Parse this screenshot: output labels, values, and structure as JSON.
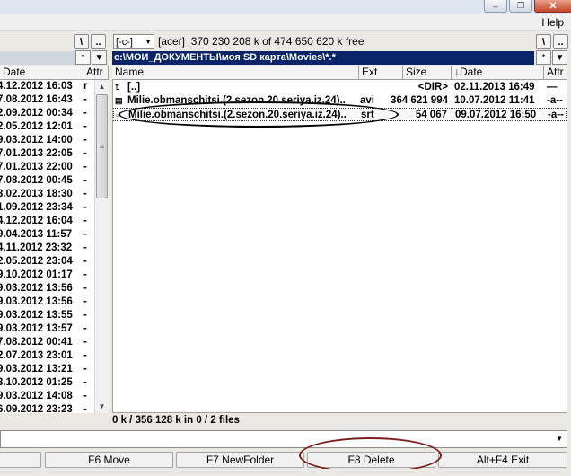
{
  "menu": {
    "help": "Help"
  },
  "window_buttons": {
    "minimize": "–",
    "maximize": "❐",
    "close": "✕"
  },
  "toolbar": {
    "root_button": "\\",
    "parent_button": "..",
    "hist_button": "*",
    "dropdown_arrow": "▼"
  },
  "right_drive": {
    "drive": "[-c-]",
    "label": "[acer]",
    "free_space": "370 230 208 k of 474 650 620 k free"
  },
  "right_path": "c:\\МОИ_ДОКУМЕНТЫ\\моя SD карта\\Movies\\*.*",
  "left_headers": {
    "date": "Date",
    "attr": "Attr"
  },
  "right_headers": {
    "name": "Name",
    "ext": "Ext",
    "size": "Size",
    "date": "↓Date",
    "attr": "Attr"
  },
  "left_rows": [
    {
      "date": "4.12.2012 16:03",
      "attr": "r"
    },
    {
      "date": "7.08.2012 16:43",
      "attr": "-"
    },
    {
      "date": "2.09.2012 00:34",
      "attr": "-"
    },
    {
      "date": "2.05.2012 12:01",
      "attr": "-"
    },
    {
      "date": "9.03.2012 14:00",
      "attr": "-"
    },
    {
      "date": "7.01.2013 22:05",
      "attr": "-"
    },
    {
      "date": "7.01.2013 22:00",
      "attr": "-"
    },
    {
      "date": "7.08.2012 00:45",
      "attr": "-"
    },
    {
      "date": "3.02.2013 18:30",
      "attr": "-"
    },
    {
      "date": "1.09.2012 23:34",
      "attr": "-"
    },
    {
      "date": "4.12.2012 16:04",
      "attr": "-"
    },
    {
      "date": "9.04.2013 11:57",
      "attr": "-"
    },
    {
      "date": "4.11.2012 23:32",
      "attr": "-"
    },
    {
      "date": "2.05.2012 23:04",
      "attr": "-"
    },
    {
      "date": "9.10.2012 01:17",
      "attr": "-"
    },
    {
      "date": "9.03.2012 13:56",
      "attr": "-"
    },
    {
      "date": "9.03.2012 13:56",
      "attr": "-"
    },
    {
      "date": "9.03.2012 13:55",
      "attr": "-"
    },
    {
      "date": "9.03.2012 13:57",
      "attr": "-"
    },
    {
      "date": "7.08.2012 00:41",
      "attr": "-"
    },
    {
      "date": "2.07.2013 23:01",
      "attr": "-"
    },
    {
      "date": "9.03.2012 13:21",
      "attr": "-"
    },
    {
      "date": "3.10.2012 01:25",
      "attr": "-"
    },
    {
      "date": "9.03.2012 14:08",
      "attr": "-"
    },
    {
      "date": "6.09.2012 23:23",
      "attr": "-"
    }
  ],
  "right_rows": [
    {
      "icon": "up-dir-icon",
      "glyph": "⮤",
      "name": "[..]",
      "ext": "",
      "size": "<DIR>",
      "date": "02.11.2013 16:49",
      "attr": "—"
    },
    {
      "icon": "video-file-icon",
      "glyph": "▤",
      "name": "Milie.obmanschitsi.(2.sezon.20.seriya.iz.24)..",
      "ext": "avi",
      "size": "364 621 994",
      "date": "10.07.2012 11:41",
      "attr": "-a--"
    },
    {
      "icon": "text-file-icon",
      "glyph": "▫",
      "name": "Milie.obmanschitsi.(2.sezon.20.seriya.iz.24)..",
      "ext": "srt",
      "size": "54 067",
      "date": "09.07.2012 16:50",
      "attr": "-a--"
    }
  ],
  "status": {
    "right": "0 k / 356 128 k in 0 / 2 files"
  },
  "command_line": {
    "value": ""
  },
  "fkeys": [
    {
      "id": "f5",
      "label": ""
    },
    {
      "id": "f6",
      "label": "F6 Move"
    },
    {
      "id": "f7",
      "label": "F7 NewFolder"
    },
    {
      "id": "f8",
      "label": "F8 Delete"
    },
    {
      "id": "exit",
      "label": "Alt+F4 Exit"
    }
  ]
}
